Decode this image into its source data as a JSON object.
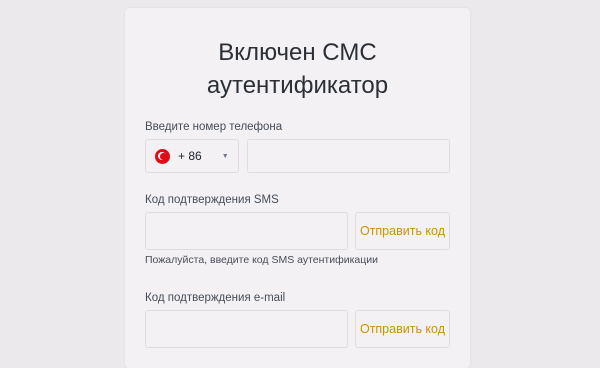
{
  "dialog": {
    "title_line1": "Включен СМС",
    "title_line2": "аутентификатор"
  },
  "phone": {
    "label": "Введите номер телефона",
    "country_code": "+ 86",
    "flag_icon": "turkey-flag-icon",
    "caret_icon": "caret-down-icon",
    "value": "",
    "placeholder": ""
  },
  "sms": {
    "label": "Код подтверждения SMS",
    "value": "",
    "send_label": "Отправить код",
    "hint": "Пожалуйста, введите код SMS аутентификации"
  },
  "email": {
    "label": "Код подтверждения e-mail",
    "value": "",
    "send_label": "Отправить код"
  },
  "colors": {
    "accent": "#c99400",
    "background": "#ece9ed",
    "card": "#f3f1f4"
  }
}
